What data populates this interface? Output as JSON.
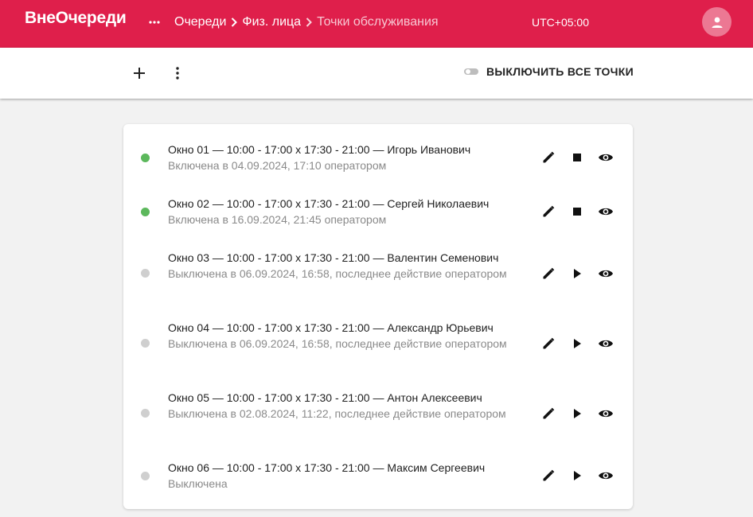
{
  "app": {
    "logo": "ВнеОчереди",
    "timezone": "UTC+05:00"
  },
  "breadcrumbs": [
    {
      "label": "Очереди"
    },
    {
      "label": "Физ. лица"
    },
    {
      "label": "Точки обслуживания"
    }
  ],
  "toolbar": {
    "toggle_all_label": "ВЫКЛЮЧИТЬ ВСЕ ТОЧКИ",
    "toggle_all_on": false
  },
  "icons": {
    "menu": "more-horiz-icon",
    "user": "account-icon",
    "add": "plus-icon",
    "more": "more-vert-icon",
    "edit": "pencil-icon",
    "stop": "stop-icon",
    "start": "play-icon",
    "view": "eye-icon"
  },
  "colors": {
    "brand": "#df1f4b",
    "active": "#5cb85c",
    "inactive": "#cfcfcf",
    "muted": "#8a8a8a"
  },
  "points": [
    {
      "title": "Окно 01 — 10:00 - 17:00 x 17:30 - 21:00 — Игорь Иванович",
      "status": "Включена в 04.09.2024, 17:10 оператором",
      "active": true
    },
    {
      "title": "Окно 02 — 10:00 - 17:00 x 17:30 - 21:00 — Сергей Николаевич",
      "status": "Включена в 16.09.2024, 21:45 оператором",
      "active": true
    },
    {
      "title": "Окно 03 — 10:00 - 17:00 x 17:30 - 21:00 — Валентин Семенович",
      "status": "Выключена в 06.09.2024, 16:58, последнее действие оператором",
      "active": false
    },
    {
      "title": "Окно 04 — 10:00 - 17:00 x 17:30 - 21:00 — Александр Юрьевич",
      "status": "Выключена в 06.09.2024, 16:58, последнее действие оператором",
      "active": false
    },
    {
      "title": "Окно 05 — 10:00 - 17:00 x 17:30 - 21:00 — Антон Алексеевич",
      "status": "Выключена в 02.08.2024, 11:22, последнее действие оператором",
      "active": false
    },
    {
      "title": "Окно 06 — 10:00 - 17:00 x 17:30 - 21:00 — Максим Сергеевич",
      "status": "Выключена",
      "active": false
    }
  ]
}
